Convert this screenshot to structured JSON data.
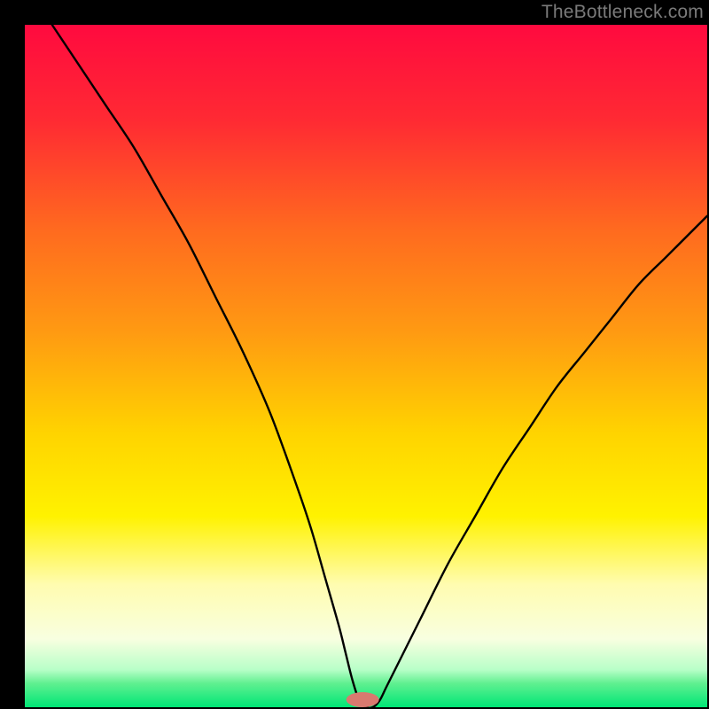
{
  "watermark": "TheBottleneck.com",
  "layout": {
    "outer_w": 800,
    "outer_h": 800,
    "inner_x": 28,
    "inner_y": 28,
    "inner_w": 770,
    "inner_h": 770
  },
  "gradient_stops": [
    {
      "offset": 0.0,
      "color": "#ff0a3f"
    },
    {
      "offset": 0.14,
      "color": "#ff2a33"
    },
    {
      "offset": 0.3,
      "color": "#ff6a1f"
    },
    {
      "offset": 0.45,
      "color": "#ff9a12"
    },
    {
      "offset": 0.6,
      "color": "#ffd400"
    },
    {
      "offset": 0.72,
      "color": "#fff200"
    },
    {
      "offset": 0.82,
      "color": "#fffcb0"
    },
    {
      "offset": 0.9,
      "color": "#f8ffe0"
    },
    {
      "offset": 0.945,
      "color": "#b8ffc8"
    },
    {
      "offset": 0.965,
      "color": "#60f090"
    },
    {
      "offset": 1.0,
      "color": "#00e676"
    }
  ],
  "marker": {
    "cx": 0.495,
    "cy": 0.989,
    "rx": 0.024,
    "ry": 0.011,
    "fill": "#d9796f"
  },
  "curve_style": {
    "stroke": "#000000",
    "width": 2.4
  },
  "chart_data": {
    "type": "line",
    "title": "",
    "xlabel": "",
    "ylabel": "",
    "xlim": [
      0,
      100
    ],
    "ylim": [
      0,
      100
    ],
    "series": [
      {
        "name": "bottleneck-curve",
        "x": [
          4,
          8,
          12,
          16,
          20,
          24,
          28,
          32,
          36,
          40,
          42,
          44,
          46,
          47,
          48,
          49,
          50,
          51,
          52,
          53,
          55,
          58,
          62,
          66,
          70,
          74,
          78,
          82,
          86,
          90,
          94,
          98,
          100
        ],
        "y": [
          100,
          94,
          88,
          82,
          75,
          68,
          60,
          52,
          43,
          32,
          26,
          19,
          12,
          8,
          4,
          1,
          0,
          0,
          1,
          3,
          7,
          13,
          21,
          28,
          35,
          41,
          47,
          52,
          57,
          62,
          66,
          70,
          72
        ]
      }
    ],
    "annotations": [
      {
        "text": "TheBottleneck.com",
        "x": 100,
        "y": 100,
        "loc": "top-right"
      }
    ],
    "optimum_marker": {
      "x": 49.5,
      "y": 0
    }
  }
}
